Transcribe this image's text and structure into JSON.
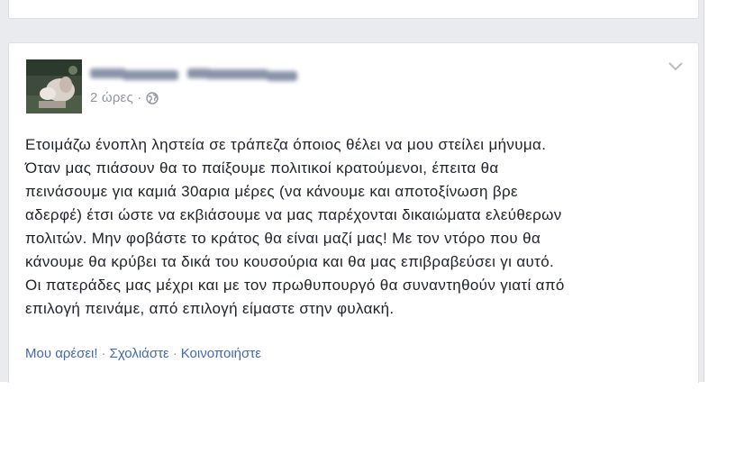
{
  "post": {
    "timestamp": "2 ώρες ·",
    "privacy_icon": "globe-icon",
    "options_icon": "chevron-down-icon",
    "lines": [
      "Ετοιμάζω ένοπλη ληστεία σε τράπεζα όποιος θέλει να μου στείλει μήνυμα.",
      "Όταν μας πιάσουν θα το παίξουμε πολιτικοί κρατούμενοι, έπειτα θα",
      "πεινάσουμε για καμιά 30αρια μέρες (να κάνουμε και αποτοξίνωση βρε",
      "αδερφέ) έτσι ώστε να εκβιάσουμε να μας παρέχονται δικαιώματα ελεύθερων",
      "πολιτών. Μην φοβάστε το κράτος θα είναι μαζί μας! Με τον ντόρο που θα",
      "κάνουμε θα κρύβει τα δικά του κουσούρια και θα μας επιβραβεύσει γι αυτό.",
      "Οι πατεράδες μας μέχρι και με τον πρωθυπουργό θα συναντηθούν γιατί από",
      "επιλογή πεινάμε, από επιλογή είμαστε στην φυλακή."
    ],
    "actions": {
      "like": "Μου αρέσει!",
      "separator": "·",
      "comment": "Σχολιάστε",
      "share": "Κοινοποιήστε"
    }
  },
  "colors": {
    "feed_background": "#e9ebee",
    "link": "#4267b2",
    "meta_text": "#90949c",
    "body_text": "#1d2129"
  }
}
